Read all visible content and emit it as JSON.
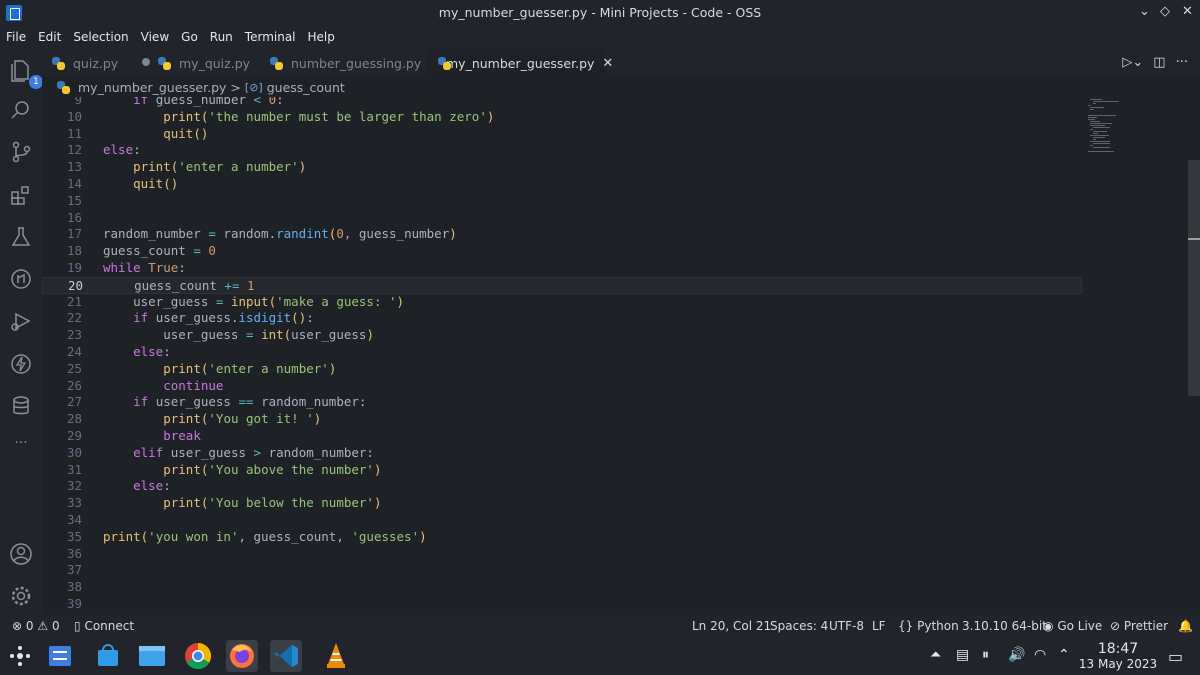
{
  "window": {
    "title": "my_number_guesser.py - Mini Projects - Code - OSS",
    "controls": [
      "⌄",
      "◇",
      "✕"
    ]
  },
  "menu": [
    "File",
    "Edit",
    "Selection",
    "View",
    "Go",
    "Run",
    "Terminal",
    "Help"
  ],
  "activity": {
    "badge": "1",
    "more": "···"
  },
  "tabs": [
    {
      "label": "quiz.py",
      "active": false,
      "modified": true
    },
    {
      "label": "my_quiz.py",
      "active": false
    },
    {
      "label": "number_guessing.py",
      "active": false
    },
    {
      "label": "my_number_guesser.py",
      "active": true
    }
  ],
  "breadcrumb": {
    "file": "my_number_guesser.py",
    "separator": ">",
    "symbol_icon": "[⊘]",
    "symbol": "guess_count"
  },
  "editor": {
    "current_line": 20,
    "lines": [
      {
        "n": "9",
        "html": "    <span class=\"k\">if</span> guess_number <span class=\"op\">&lt;</span> <span class=\"n\">0</span>:"
      },
      {
        "n": "10",
        "html": "        <span class=\"fn\">print</span><span class=\"p\">(</span><span class=\"s\">'the number must be larger than zero'</span><span class=\"p\">)</span>"
      },
      {
        "n": "11",
        "html": "        <span class=\"fn\">quit</span><span class=\"p\">()</span>"
      },
      {
        "n": "12",
        "html": "<span class=\"k\">else</span>:"
      },
      {
        "n": "13",
        "html": "    <span class=\"fn\">print</span><span class=\"p\">(</span><span class=\"s\">'enter a number'</span><span class=\"p\">)</span>"
      },
      {
        "n": "14",
        "html": "    <span class=\"fn\">quit</span><span class=\"p\">()</span>"
      },
      {
        "n": "15",
        "html": ""
      },
      {
        "n": "16",
        "html": ""
      },
      {
        "n": "17",
        "html": "random_number <span class=\"op\">=</span> random.<span class=\"m\">randint</span><span class=\"p\">(</span><span class=\"n\">0</span>, guess_number<span class=\"p\">)</span>"
      },
      {
        "n": "18",
        "html": "guess_count <span class=\"op\">=</span> <span class=\"n\">0</span>"
      },
      {
        "n": "19",
        "html": "<span class=\"k\">while</span> <span class=\"n\">True</span>:"
      },
      {
        "n": "20",
        "html": "    guess_count <span class=\"op\">+=</span> <span class=\"n\">1</span>"
      },
      {
        "n": "21",
        "html": "    user_guess <span class=\"op\">=</span> <span class=\"fn\">input</span><span class=\"p\">(</span><span class=\"s\">'make a guess: '</span><span class=\"p\">)</span>"
      },
      {
        "n": "22",
        "html": "    <span class=\"k\">if</span> user_guess.<span class=\"m\">isdigit</span><span class=\"p\">()</span>:"
      },
      {
        "n": "23",
        "html": "        user_guess <span class=\"op\">=</span> <span class=\"fn\">int</span><span class=\"p\">(</span>user_guess<span class=\"p\">)</span>"
      },
      {
        "n": "24",
        "html": "    <span class=\"k\">else</span>:"
      },
      {
        "n": "25",
        "html": "        <span class=\"fn\">print</span><span class=\"p\">(</span><span class=\"s\">'enter a number'</span><span class=\"p\">)</span>"
      },
      {
        "n": "26",
        "html": "        <span class=\"k\">continue</span>"
      },
      {
        "n": "27",
        "html": "    <span class=\"k\">if</span> user_guess <span class=\"op\">==</span> random_number:"
      },
      {
        "n": "28",
        "html": "        <span class=\"fn\">print</span><span class=\"p\">(</span><span class=\"s\">'You got it! '</span><span class=\"p\">)</span>"
      },
      {
        "n": "29",
        "html": "        <span class=\"k\">break</span>"
      },
      {
        "n": "30",
        "html": "    <span class=\"k\">elif</span> user_guess <span class=\"op\">&gt;</span> random_number:"
      },
      {
        "n": "31",
        "html": "        <span class=\"fn\">print</span><span class=\"p\">(</span><span class=\"s\">'You above the number'</span><span class=\"p\">)</span>"
      },
      {
        "n": "32",
        "html": "    <span class=\"k\">else</span>:"
      },
      {
        "n": "33",
        "html": "        <span class=\"fn\">print</span><span class=\"p\">(</span><span class=\"s\">'You below the number'</span><span class=\"p\">)</span>"
      },
      {
        "n": "34",
        "html": ""
      },
      {
        "n": "35",
        "html": "<span class=\"fn\">print</span><span class=\"p\">(</span><span class=\"s\">'you won in'</span>, guess_count, <span class=\"s\">'guesses'</span><span class=\"p\">)</span>"
      },
      {
        "n": "36",
        "html": ""
      },
      {
        "n": "37",
        "html": ""
      },
      {
        "n": "38",
        "html": ""
      },
      {
        "n": "39",
        "html": ""
      }
    ]
  },
  "status": {
    "errors": "0",
    "warnings": "0",
    "connect": "Connect",
    "position": "Ln 20, Col 21",
    "spaces": "Spaces: 4",
    "encoding": "UTF-8",
    "eol": "LF",
    "language": "Python",
    "interpreter": "3.10.10 64-bit",
    "golive": "Go Live",
    "prettier": "Prettier"
  },
  "taskbar": {
    "time": "18:47",
    "date": "13 May 2023"
  }
}
